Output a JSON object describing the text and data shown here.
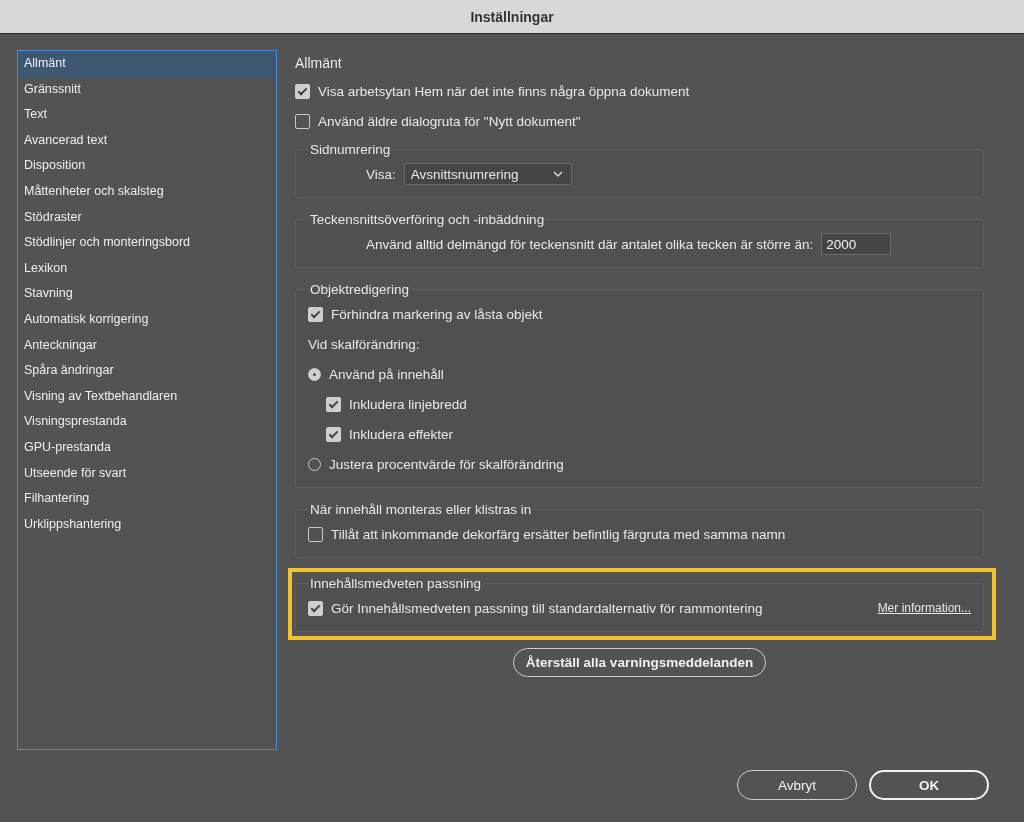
{
  "window": {
    "title": "Inställningar"
  },
  "sidebar": {
    "items": [
      {
        "label": "Allmänt",
        "selected": true
      },
      {
        "label": "Gränssnitt",
        "selected": false
      },
      {
        "label": "Text",
        "selected": false
      },
      {
        "label": "Avancerad text",
        "selected": false
      },
      {
        "label": "Disposition",
        "selected": false
      },
      {
        "label": "Måttenheter och skalsteg",
        "selected": false
      },
      {
        "label": "Stödraster",
        "selected": false
      },
      {
        "label": "Stödlinjer och monteringsbord",
        "selected": false
      },
      {
        "label": "Lexikon",
        "selected": false
      },
      {
        "label": "Stavning",
        "selected": false
      },
      {
        "label": "Automatisk korrigering",
        "selected": false
      },
      {
        "label": "Anteckningar",
        "selected": false
      },
      {
        "label": "Spåra ändringar",
        "selected": false
      },
      {
        "label": "Visning av Textbehandlaren",
        "selected": false
      },
      {
        "label": "Visningsprestanda",
        "selected": false
      },
      {
        "label": "GPU-prestanda",
        "selected": false
      },
      {
        "label": "Utseende för svart",
        "selected": false
      },
      {
        "label": "Filhantering",
        "selected": false
      },
      {
        "label": "Urklippshantering",
        "selected": false
      }
    ]
  },
  "panel": {
    "heading": "Allmänt",
    "options": [
      {
        "kind": "checkbox",
        "label": "Visa arbetsytan Hem när det inte finns några öppna dokument",
        "checked": true
      },
      {
        "kind": "checkbox",
        "label": "Använd äldre dialogruta för \"Nytt dokument\"",
        "checked": false
      }
    ],
    "groups": [
      {
        "title": "Sidnumrering",
        "highlighted": false,
        "rows": [
          {
            "kind": "select",
            "label": "Visa:",
            "value": "Avsnittsnumrering"
          }
        ]
      },
      {
        "title": "Teckensnittsöverföring och -inbäddning",
        "highlighted": false,
        "rows": [
          {
            "kind": "number",
            "label": "Använd alltid delmängd för teckensnitt där antalet olika tecken är större än:",
            "value": "2000"
          }
        ]
      },
      {
        "title": "Objektredigering",
        "highlighted": false,
        "rows": [
          {
            "kind": "checkbox",
            "label": "Förhindra markering av låsta objekt",
            "checked": true
          },
          {
            "kind": "text",
            "label": "Vid skalförändring:"
          },
          {
            "kind": "radio",
            "label": "Använd på innehåll",
            "selected": true,
            "children": [
              {
                "kind": "checkbox",
                "label": "Inkludera linjebredd",
                "checked": true
              },
              {
                "kind": "checkbox",
                "label": "Inkludera effekter",
                "checked": true
              }
            ]
          },
          {
            "kind": "radio",
            "label": "Justera procentvärde för skalförändring",
            "selected": false
          }
        ]
      },
      {
        "title": "När innehåll monteras eller klistras in",
        "highlighted": false,
        "rows": [
          {
            "kind": "checkbox",
            "label": "Tillåt att inkommande dekorfärg ersätter befintlig färgruta med samma namn",
            "checked": false
          }
        ]
      },
      {
        "title": "Innehållsmedveten passning",
        "highlighted": true,
        "rows": [
          {
            "kind": "checkbox",
            "label": "Gör Innehållsmedveten passning till standardalternativ för rammontering",
            "checked": true,
            "link": "Mer information..."
          }
        ]
      }
    ],
    "reset_button": "Återställ alla varningsmeddelanden"
  },
  "buttons": [
    {
      "label": "Avbryt",
      "default": false
    },
    {
      "label": "OK",
      "default": true
    }
  ]
}
